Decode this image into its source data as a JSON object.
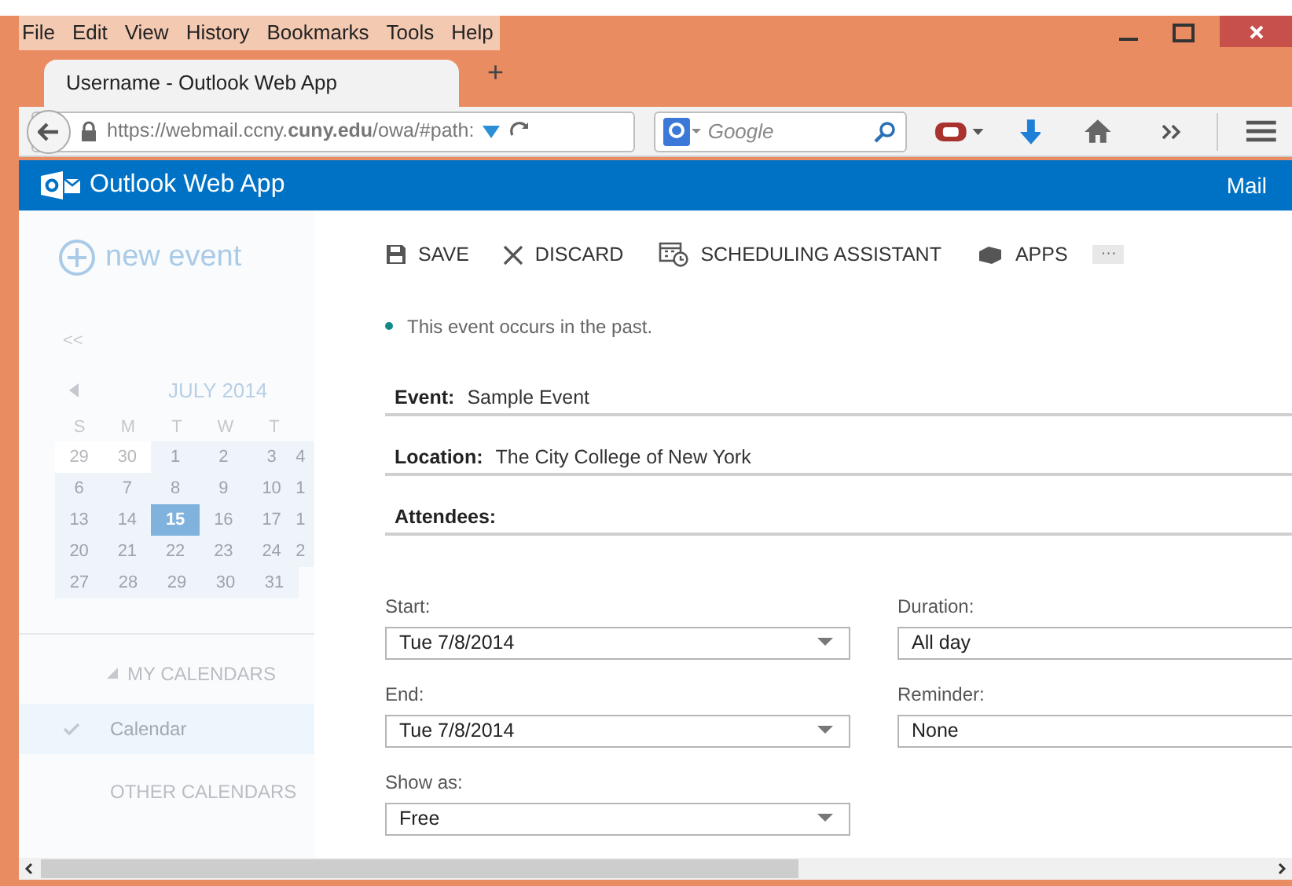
{
  "menu": [
    {
      "label": "File"
    },
    {
      "label": "Edit"
    },
    {
      "label": "View"
    },
    {
      "label": "History"
    },
    {
      "label": "Bookmarks"
    },
    {
      "label": "Tools"
    },
    {
      "label": "Help"
    }
  ],
  "tab": {
    "title": "Username - Outlook Web App",
    "new_tab": "+"
  },
  "address": {
    "url": "https://webmail.ccny.**cuny.edu**/owa/#path:"
  },
  "search": {
    "placeholder": "Google"
  },
  "app_bar": {
    "title": "Outlook Web App",
    "section": "Mail"
  },
  "sidebar": {
    "new_event": "new event",
    "collapse": "<<",
    "month": "JULY 2014",
    "weekdays": [
      "S",
      "M",
      "T",
      "W",
      "T"
    ],
    "weeks": [
      [
        {
          "day": "29",
          "other_month": true,
          "selected": false
        },
        {
          "day": "30",
          "other_month": true,
          "selected": false
        },
        {
          "day": "1",
          "other_month": false,
          "selected": false
        },
        {
          "day": "2",
          "other_month": false,
          "selected": false
        },
        {
          "day": "3",
          "other_month": false,
          "selected": false
        },
        {
          "day": "4",
          "other_month": false,
          "selected": false
        }
      ],
      [
        {
          "day": "6",
          "other_month": false,
          "selected": false
        },
        {
          "day": "7",
          "other_month": false,
          "selected": false
        },
        {
          "day": "8",
          "other_month": false,
          "selected": false
        },
        {
          "day": "9",
          "other_month": false,
          "selected": false
        },
        {
          "day": "10",
          "other_month": false,
          "selected": false
        },
        {
          "day": "1",
          "other_month": false,
          "selected": false
        }
      ],
      [
        {
          "day": "13",
          "other_month": false,
          "selected": false
        },
        {
          "day": "14",
          "other_month": false,
          "selected": false
        },
        {
          "day": "15",
          "other_month": false,
          "selected": true
        },
        {
          "day": "16",
          "other_month": false,
          "selected": false
        },
        {
          "day": "17",
          "other_month": false,
          "selected": false
        },
        {
          "day": "1",
          "other_month": false,
          "selected": false
        }
      ],
      [
        {
          "day": "20",
          "other_month": false,
          "selected": false
        },
        {
          "day": "21",
          "other_month": false,
          "selected": false
        },
        {
          "day": "22",
          "other_month": false,
          "selected": false
        },
        {
          "day": "23",
          "other_month": false,
          "selected": false
        },
        {
          "day": "24",
          "other_month": false,
          "selected": false
        },
        {
          "day": "2",
          "other_month": false,
          "selected": false
        }
      ],
      [
        {
          "day": "27",
          "other_month": false,
          "selected": false
        },
        {
          "day": "28",
          "other_month": false,
          "selected": false
        },
        {
          "day": "29",
          "other_month": false,
          "selected": false
        },
        {
          "day": "30",
          "other_month": false,
          "selected": false
        },
        {
          "day": "31",
          "other_month": false,
          "selected": false
        }
      ]
    ],
    "my_calendars": {
      "label": "MY CALENDARS",
      "expanded": true
    },
    "calendars": [
      {
        "name": "Calendar",
        "checked": true,
        "selected": true
      }
    ],
    "other_calendars": "OTHER CALENDARS"
  },
  "toolbar": [
    {
      "kind": "save",
      "label": "SAVE"
    },
    {
      "kind": "discard",
      "label": "DISCARD"
    },
    {
      "kind": "scheduling",
      "label": "SCHEDULING ASSISTANT"
    },
    {
      "kind": "apps",
      "label": "APPS"
    },
    {
      "kind": "more",
      "label": "···"
    }
  ],
  "notice": "This event occurs in the past.",
  "fields": [
    {
      "label": "Event:",
      "value": "Sample Event"
    },
    {
      "label": "Location:",
      "value": "The City College of New York"
    },
    {
      "label": "Attendees:"
    }
  ],
  "selects": [
    {
      "label": "Start:",
      "value": "Tue 7/8/2014",
      "caret": true
    },
    {
      "label": "Duration:",
      "value": "All day",
      "caret": false
    },
    {
      "label": "End:",
      "value": "Tue 7/8/2014",
      "caret": true
    },
    {
      "label": "Reminder:",
      "value": "None",
      "caret": false
    },
    {
      "label": "Show as:",
      "value": "Free",
      "caret": true
    }
  ]
}
